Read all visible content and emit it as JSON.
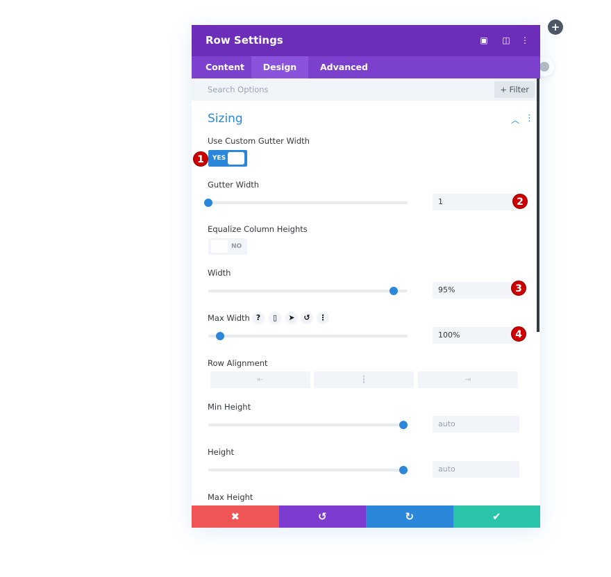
{
  "panel": {
    "title": "Row Settings",
    "header_icons": [
      "fullscreen-icon",
      "split-view-icon",
      "more-icon"
    ]
  },
  "tabs": [
    {
      "label": "Content"
    },
    {
      "label": "Design",
      "active": true
    },
    {
      "label": "Advanced"
    }
  ],
  "search": {
    "placeholder": "Search Options",
    "filter_label": "+ Filter"
  },
  "section": {
    "title": "Sizing"
  },
  "fields": {
    "custom_gutter": {
      "label": "Use Custom Gutter Width",
      "value": "YES"
    },
    "gutter_width": {
      "label": "Gutter Width",
      "value": "1",
      "slider_fraction": 0
    },
    "equalize": {
      "label": "Equalize Column Heights",
      "value": "NO"
    },
    "width": {
      "label": "Width",
      "value": "95%",
      "slider_fraction": 0.93
    },
    "max_width": {
      "label": "Max Width",
      "value": "100%",
      "slider_fraction": 0.06
    },
    "row_alignment": {
      "label": "Row Alignment",
      "options": [
        "left",
        "center",
        "right"
      ]
    },
    "min_height": {
      "label": "Min Height",
      "value": "auto",
      "slider_fraction": 0.98
    },
    "height": {
      "label": "Height",
      "value": "auto",
      "slider_fraction": 0.98
    },
    "max_height": {
      "label": "Max Height"
    }
  },
  "badges": [
    "1",
    "2",
    "3",
    "4"
  ],
  "footer": {
    "colors": {
      "cancel": "#ef5555",
      "undo": "#7e3bd0",
      "redo": "#2b87da",
      "save": "#29c4a9"
    }
  },
  "colors": {
    "header": "#6c2eb9",
    "tabs": "#7b40cc",
    "accent": "#2b87da"
  }
}
